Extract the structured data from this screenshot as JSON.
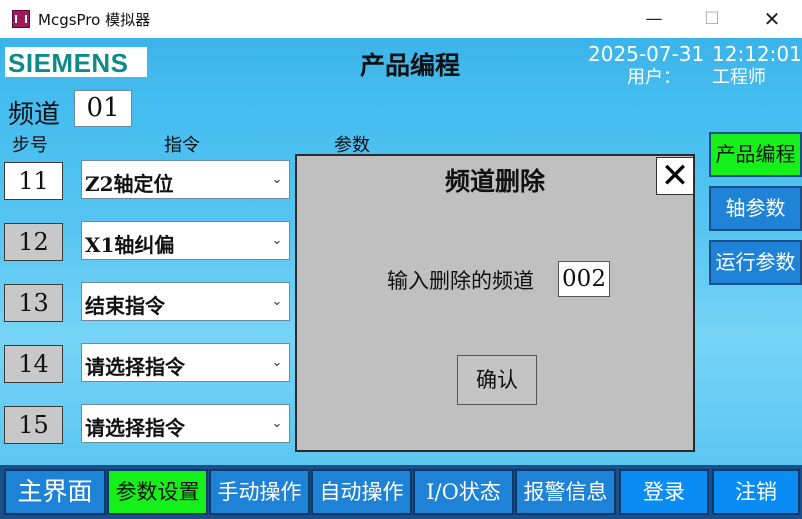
{
  "window": {
    "title": "McgsPro 模拟器",
    "min_glyph": "—",
    "max_glyph": "☐",
    "close_glyph": "✕"
  },
  "header": {
    "logo_text": "SIEMENS",
    "title": "产品编程",
    "date": "2025-07-31",
    "time": "12:12:01",
    "user_label": "用户：",
    "user_name": "工程师"
  },
  "channel": {
    "label": "频道",
    "value": "01"
  },
  "columns": {
    "step": "步号",
    "command": "指令",
    "param": "参数"
  },
  "steps": [
    {
      "number": "11",
      "command": "Z2轴定位",
      "active": true
    },
    {
      "number": "12",
      "command": "X1轴纠偏",
      "active": false
    },
    {
      "number": "13",
      "command": "结束指令",
      "active": false
    },
    {
      "number": "14",
      "command": "请选择指令",
      "active": false
    },
    {
      "number": "15",
      "command": "请选择指令",
      "active": false
    }
  ],
  "dropdown_glyph": "⌄",
  "side_nav": [
    {
      "label": "产品编程",
      "current": true
    },
    {
      "label": "轴参数",
      "current": false
    },
    {
      "label": "运行参数",
      "current": false
    }
  ],
  "dialog": {
    "title": "频道删除",
    "close_glyph": "✕",
    "prompt": "输入删除的频道",
    "input_value": "002",
    "confirm_label": "确认"
  },
  "bottom_nav": [
    {
      "label": "主界面"
    },
    {
      "label": "参数设置"
    },
    {
      "label": "手动操作"
    },
    {
      "label": "自动操作"
    },
    {
      "label": "I/O状态"
    },
    {
      "label": "报警信息"
    },
    {
      "label": "登录"
    },
    {
      "label": "注销"
    }
  ],
  "colors": {
    "background": "#4fc1ef",
    "button_blue": "#1e82d6",
    "active_green": "#16f01a",
    "dialog_gray": "#c0c0c0",
    "nav_dark": "#1a4f8a"
  }
}
